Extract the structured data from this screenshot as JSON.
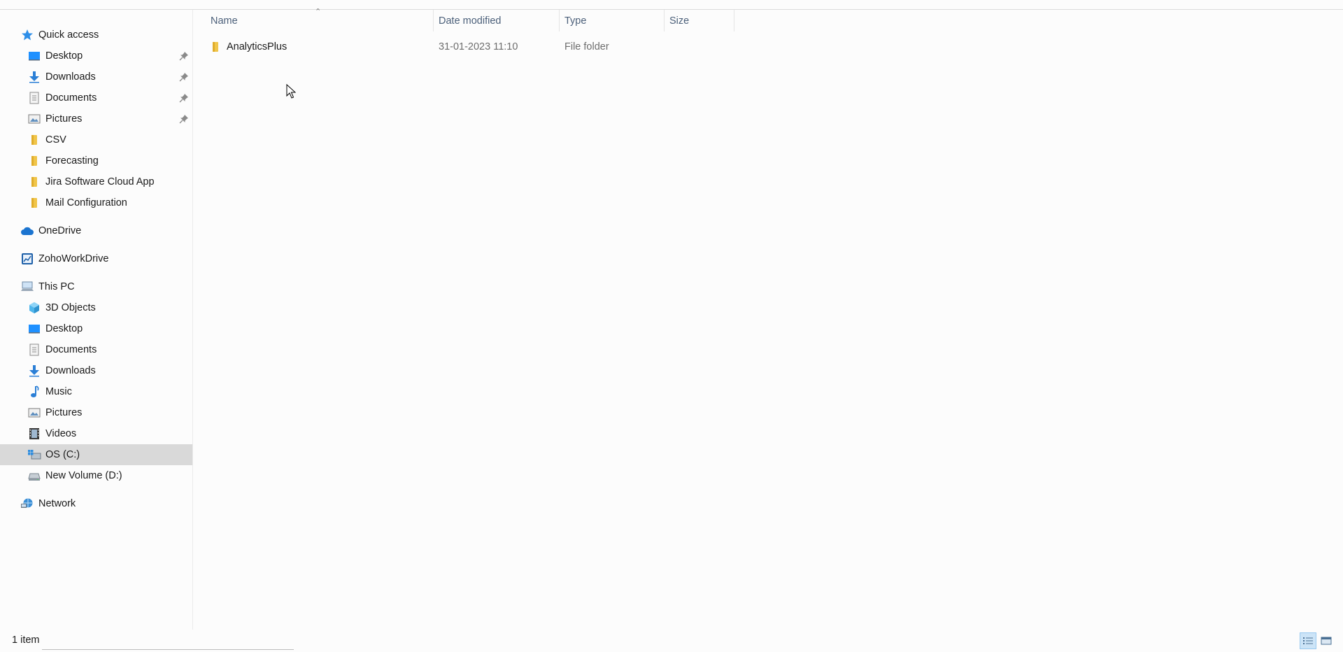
{
  "sidebar": {
    "quick_access": {
      "label": "Quick access",
      "items": [
        {
          "label": "Desktop",
          "icon": "desktop-icon",
          "pinned": true
        },
        {
          "label": "Downloads",
          "icon": "download-icon",
          "pinned": true
        },
        {
          "label": "Documents",
          "icon": "documents-icon",
          "pinned": true
        },
        {
          "label": "Pictures",
          "icon": "pictures-icon",
          "pinned": true
        },
        {
          "label": "CSV",
          "icon": "folder-icon",
          "pinned": false
        },
        {
          "label": "Forecasting",
          "icon": "folder-icon",
          "pinned": false
        },
        {
          "label": "Jira Software Cloud App",
          "icon": "folder-icon",
          "pinned": false
        },
        {
          "label": "Mail Configuration",
          "icon": "folder-icon",
          "pinned": false
        }
      ]
    },
    "onedrive": {
      "label": "OneDrive"
    },
    "zohoworkdrive": {
      "label": "ZohoWorkDrive"
    },
    "this_pc": {
      "label": "This PC",
      "items": [
        {
          "label": "3D Objects",
          "icon": "3d-objects-icon"
        },
        {
          "label": "Desktop",
          "icon": "desktop-icon"
        },
        {
          "label": "Documents",
          "icon": "documents-icon"
        },
        {
          "label": "Downloads",
          "icon": "download-icon"
        },
        {
          "label": "Music",
          "icon": "music-icon"
        },
        {
          "label": "Pictures",
          "icon": "pictures-icon"
        },
        {
          "label": "Videos",
          "icon": "videos-icon"
        },
        {
          "label": "OS (C:)",
          "icon": "os-drive-icon",
          "selected": true
        },
        {
          "label": "New Volume (D:)",
          "icon": "drive-icon"
        }
      ]
    },
    "network": {
      "label": "Network"
    }
  },
  "columns": {
    "name": "Name",
    "date_modified": "Date modified",
    "type": "Type",
    "size": "Size"
  },
  "files": [
    {
      "name": "AnalyticsPlus",
      "date_modified": "31-01-2023 11:10",
      "type": "File folder",
      "size": ""
    }
  ],
  "status": {
    "item_count": "1 item"
  },
  "colors": {
    "accent": "#0078d7",
    "folder": "#f0c54a",
    "selected_bg": "#d9d9d9",
    "header_text": "#4c607a"
  }
}
